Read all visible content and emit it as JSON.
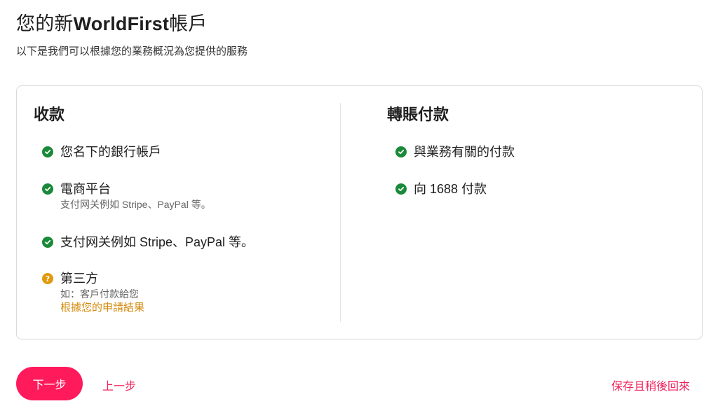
{
  "header": {
    "title_prefix": "您的新",
    "title_brand": "WorldFirst",
    "title_suffix": "帳戶",
    "subtitle": "以下是我們可以根據您的業務概況為您提供的服務"
  },
  "receive": {
    "heading": "收款",
    "items": [
      {
        "icon": "check-circle-icon",
        "label": "您名下的銀行帳戶"
      },
      {
        "icon": "check-circle-icon",
        "label": "電商平台",
        "sub": "支付网关例如 Stripe、PayPal 等。"
      },
      {
        "icon": "check-circle-icon",
        "label": "支付网关例如 Stripe、PayPal 等。"
      },
      {
        "icon": "question-circle-icon",
        "label": "第三方",
        "sub": "如：客戶付款給您",
        "link": "根據您的申請結果"
      }
    ]
  },
  "pay": {
    "heading": "轉賬付款",
    "items": [
      {
        "icon": "check-circle-icon",
        "label": "與業務有關的付款"
      },
      {
        "icon": "check-circle-icon",
        "label": "向 1688 付款"
      }
    ]
  },
  "footer": {
    "next_label": "下一步",
    "prev_label": "上一步",
    "save_label": "保存且稍後回來"
  },
  "colors": {
    "accent": "#ff1a5c",
    "success": "#1a8a3a",
    "warning": "#e09a0b"
  }
}
